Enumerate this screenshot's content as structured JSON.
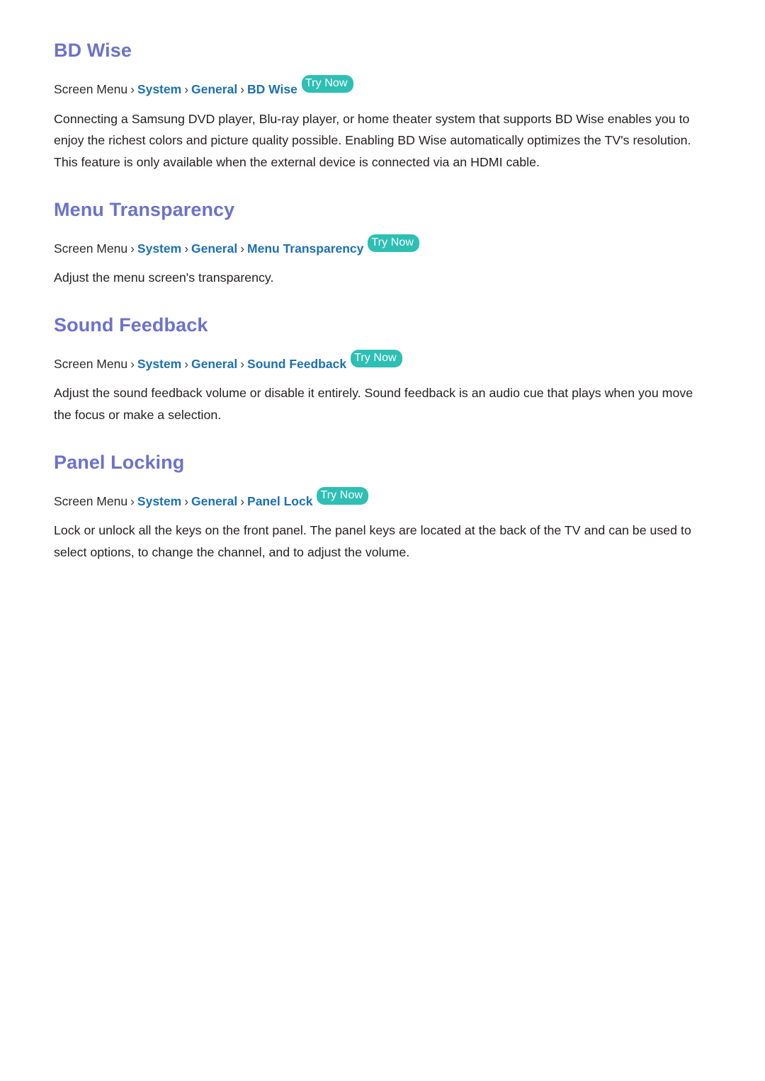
{
  "document": {
    "accent_heading_color": "#6b72cb",
    "link_color": "#1c6fb4",
    "badge_color": "#2ebfb4",
    "body_color": "#231f20",
    "background_color": "#ffffff"
  },
  "sections": [
    {
      "heading": "BD Wise",
      "breadcrumb": {
        "root": "Screen Menu",
        "sep": "›",
        "links": [
          "System",
          "General",
          "BD Wise"
        ],
        "badge": "Try Now"
      },
      "body": "Connecting a Samsung DVD player, Blu-ray player, or home theater system that supports BD Wise enables you to enjoy the richest colors and picture quality possible. Enabling BD Wise automatically optimizes the TV's resolution. This feature is only available when the external device is connected via an HDMI cable."
    },
    {
      "heading": "Menu Transparency",
      "breadcrumb": {
        "root": "Screen Menu",
        "sep": "›",
        "links": [
          "System",
          "General",
          "Menu Transparency"
        ],
        "badge": "Try Now"
      },
      "body": "Adjust the menu screen's transparency."
    },
    {
      "heading": "Sound Feedback",
      "breadcrumb": {
        "root": "Screen Menu",
        "sep": "›",
        "links": [
          "System",
          "General",
          "Sound Feedback"
        ],
        "badge": "Try Now"
      },
      "body": "Adjust the sound feedback volume or disable it entirely. Sound feedback is an audio cue that plays when you move the focus or make a selection."
    },
    {
      "heading": "Panel Locking",
      "breadcrumb": {
        "root": "Screen Menu",
        "sep": "›",
        "links": [
          "System",
          "General",
          "Panel Lock"
        ],
        "badge": "Try Now"
      },
      "body": "Lock or unlock all the keys on the front panel. The panel keys are located at the back of the TV and can be used to select options, to change the channel, and to adjust the volume."
    }
  ]
}
